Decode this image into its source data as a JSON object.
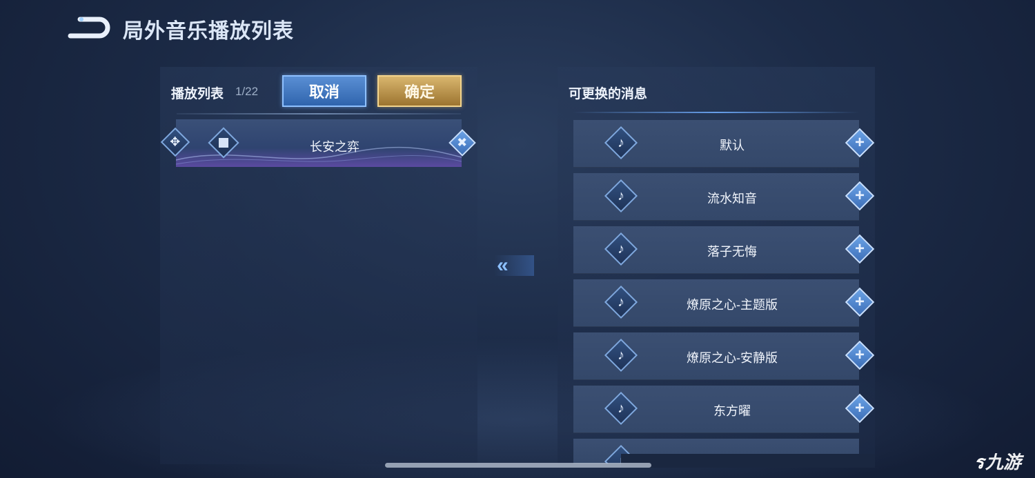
{
  "header": {
    "back_icon": "return-arrow-icon",
    "title": "局外音乐播放列表"
  },
  "playlist_panel": {
    "title": "播放列表",
    "count": "1/22",
    "cancel_label": "取消",
    "confirm_label": "确定",
    "items": [
      {
        "name": "长安之弈",
        "move_icon": "move-arrows-icon",
        "stop_icon": "stop-icon",
        "remove_icon": "close-icon"
      }
    ]
  },
  "swap_icon": "double-chevron-left-icon",
  "available_panel": {
    "title": "可更换的消息",
    "items": [
      {
        "name": "默认",
        "icon": "music-note-icon",
        "action_icon": "plus-icon"
      },
      {
        "name": "流水知音",
        "icon": "music-note-icon",
        "action_icon": "plus-icon"
      },
      {
        "name": "落子无悔",
        "icon": "music-note-icon",
        "action_icon": "plus-icon"
      },
      {
        "name": "燎原之心-主题版",
        "icon": "music-note-icon",
        "action_icon": "plus-icon"
      },
      {
        "name": "燎原之心-安静版",
        "icon": "music-note-icon",
        "action_icon": "plus-icon"
      },
      {
        "name": "东方曜",
        "icon": "music-note-icon",
        "action_icon": "plus-icon"
      }
    ]
  },
  "watermark": {
    "glyph": "ร",
    "text": "九游"
  },
  "colors": {
    "cancel_button": "#2f64ad",
    "confirm_button": "#c79d52",
    "accent_blue": "#8cc0ff"
  }
}
